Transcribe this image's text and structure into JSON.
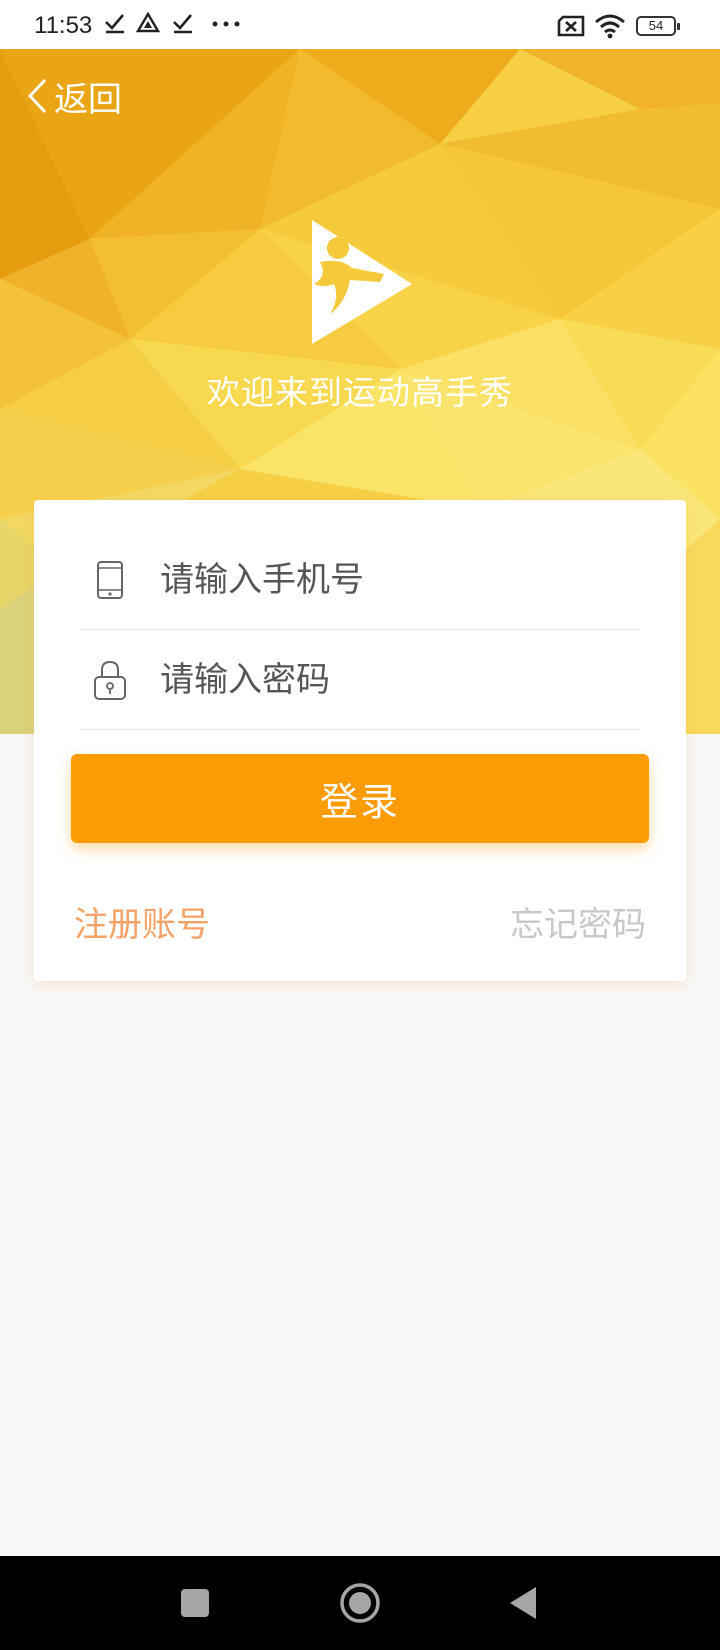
{
  "status_bar": {
    "time": "11:53",
    "battery_level": "54",
    "icons": [
      "check-icon",
      "drive-icon",
      "check-icon",
      "more-dots-icon",
      "no-sim-icon",
      "wifi-icon",
      "battery-icon"
    ]
  },
  "header": {
    "back_label": "返回",
    "welcome_text": "欢迎来到运动高手秀"
  },
  "form": {
    "phone_placeholder": "请输入手机号",
    "password_placeholder": "请输入密码",
    "login_label": "登录",
    "register_label": "注册账号",
    "forgot_label": "忘记密码"
  },
  "colors": {
    "accent": "#fb9b06",
    "register_link": "#f4a268",
    "forgot_link": "#c8c8c8",
    "hero_yellow": "#f5c93a"
  },
  "nav_bar": {
    "icons": [
      "recents-square-icon",
      "home-circle-icon",
      "back-triangle-icon"
    ]
  }
}
